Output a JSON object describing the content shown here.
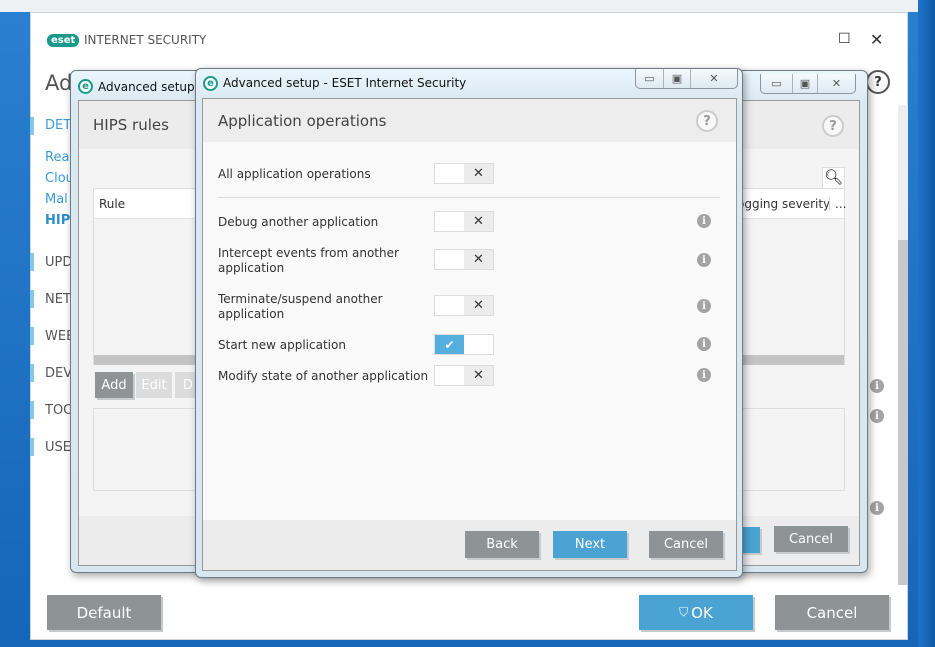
{
  "main": {
    "logo": "eset",
    "title": "INTERNET SECURITY",
    "heading": "Ad",
    "help": "?",
    "nav": [
      "DET",
      "Real",
      "Clou",
      "Mal",
      "HIPS",
      "UPD",
      "NET",
      "WEB",
      "DEV",
      "TOO",
      "USE"
    ],
    "default_label": "Default",
    "ok_label": "OK",
    "cancel_label": "Cancel"
  },
  "hips": {
    "title": "Advanced setup -",
    "heading": "HIPS rules",
    "help": "?",
    "col_rule": "Rule",
    "col_logging": "ogging severity",
    "col_more": "...",
    "add": "Add",
    "edit": "Edit",
    "delete": "D",
    "cancel": "Cancel"
  },
  "dialog": {
    "title": "Advanced setup - ESET Internet Security",
    "heading": "Application operations",
    "help": "?",
    "all_label": "All application operations",
    "all_enabled": false,
    "rows": [
      {
        "label": "Debug another application",
        "enabled": false
      },
      {
        "label": "Intercept events from another application",
        "enabled": false
      },
      {
        "label": "Terminate/suspend another application",
        "enabled": false
      },
      {
        "label": "Start new application",
        "enabled": true
      },
      {
        "label": "Modify state of another application",
        "enabled": false
      }
    ],
    "back": "Back",
    "next": "Next",
    "cancel": "Cancel"
  }
}
